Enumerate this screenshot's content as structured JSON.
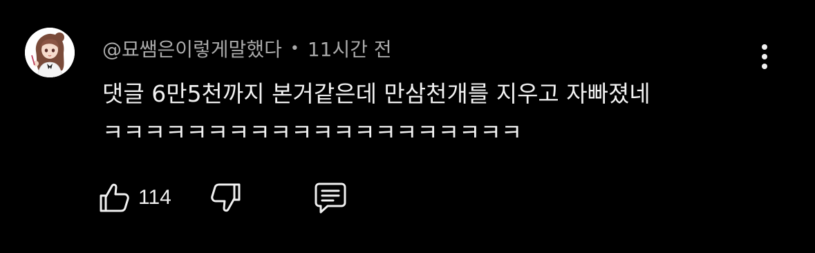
{
  "comment": {
    "author": "@묘쌤은이렇게말했다",
    "separator": "•",
    "time": "11시간 전",
    "text": "댓글 6만5천까지 본거같은데 만삼천개를 지우고 자빠졌네\nㅋㅋㅋㅋㅋㅋㅋㅋㅋㅋㅋㅋㅋㅋㅋㅋㅋㅋㅋㅋ",
    "likes": "114"
  },
  "icons": {
    "avatar": "avatar-anime-girl",
    "more": "more-vertical-icon",
    "like": "thumbs-up-icon",
    "dislike": "thumbs-down-icon",
    "reply": "comment-bubble-icon"
  },
  "colors": {
    "background": "#000000",
    "text": "#f1f1f1",
    "meta": "#aaaaaa"
  }
}
